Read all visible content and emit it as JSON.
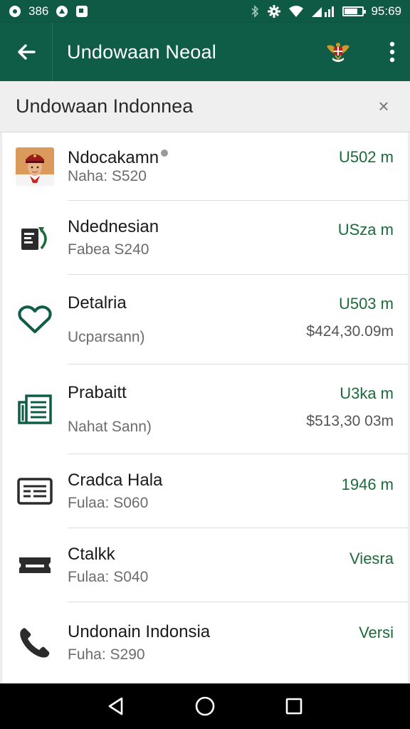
{
  "status_bar": {
    "left_text": "386",
    "time": "95:69",
    "icons": [
      "notification-icon",
      "circle-icon",
      "square-icon",
      "bluetooth-icon",
      "settings-icon",
      "wifi-icon",
      "signal-icon",
      "battery-icon"
    ],
    "battery_level": 0.8
  },
  "app_bar": {
    "title": "Undowaan Neoal",
    "back_icon": "arrow-left-icon",
    "emblem_icon": "garuda-emblem-icon",
    "menu_icon": "more-vert-icon"
  },
  "subheader": {
    "title": "Undowaan Indonnea",
    "close_label": "×"
  },
  "accent_color": "#0f5c47",
  "value_color": "#1c6b3a",
  "items": [
    {
      "icon": "avatar-person",
      "title": "Ndocakamn",
      "subtitle": "Naha: S520",
      "value": "U502 m",
      "amount": ""
    },
    {
      "icon": "document-sync-icon",
      "title": "Ndednesian",
      "subtitle": "Fabea S240",
      "value": "USza m",
      "amount": ""
    },
    {
      "icon": "heart-outline-icon",
      "title": "Detalria",
      "subtitle": "Ucparsann)",
      "value": "U503 m",
      "amount": "$424,30.09m"
    },
    {
      "icon": "newspaper-icon",
      "title": "Prabaitt",
      "subtitle": "Nahat Sann)",
      "value": "U3ka m",
      "amount": "$513,30 03m"
    },
    {
      "icon": "list-card-icon",
      "title": "Cradca Hala",
      "subtitle": "Fulaa: S060",
      "value": "1946 m",
      "amount": ""
    },
    {
      "icon": "ticket-icon",
      "title": "Ctalkk",
      "subtitle": "Fulaa: S040",
      "value": "Viesra",
      "amount": ""
    },
    {
      "icon": "phone-icon",
      "title": "Undonain Indonsia",
      "subtitle": "Fuha: S290",
      "value": "Versi",
      "amount": ""
    }
  ],
  "nav_bar": {
    "icons": [
      "back-triangle-icon",
      "home-circle-icon",
      "recents-square-icon"
    ]
  }
}
